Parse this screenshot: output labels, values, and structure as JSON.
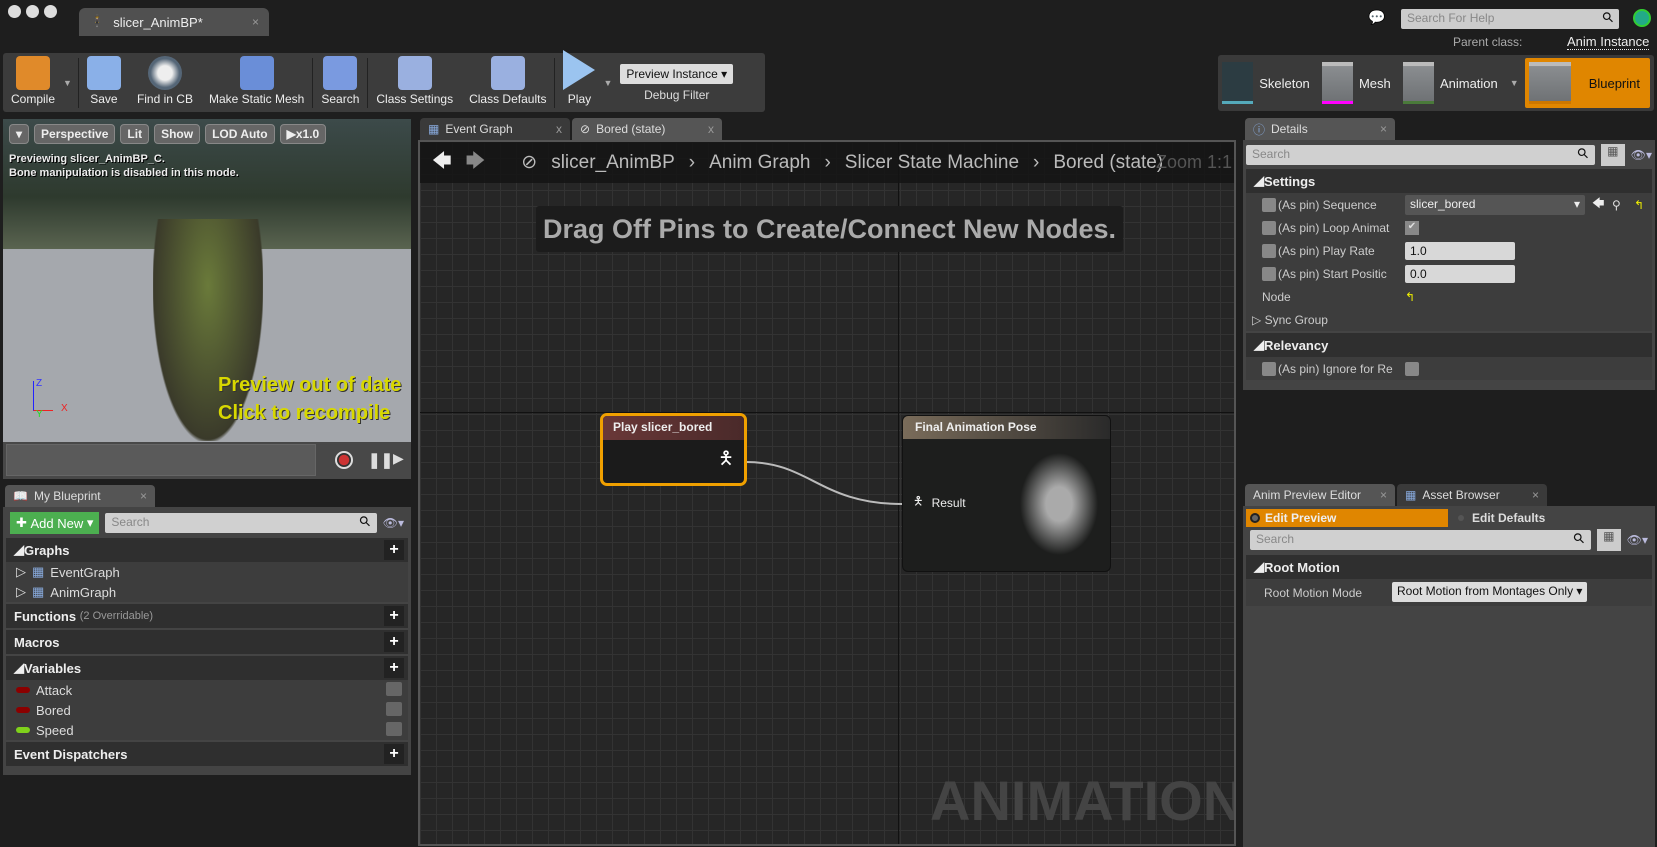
{
  "window": {
    "tab_title": "slicer_AnimBP*",
    "help_placeholder": "Search For Help",
    "parent_class_label": "Parent class:",
    "parent_class": "Anim Instance"
  },
  "toolbar": {
    "compile": "Compile",
    "save": "Save",
    "find_in_cb": "Find in CB",
    "make_static_mesh": "Make Static Mesh",
    "search": "Search",
    "class_settings": "Class Settings",
    "class_defaults": "Class Defaults",
    "play": "Play",
    "debug_select": "Preview Instance",
    "debug_filter": "Debug Filter"
  },
  "modes": {
    "skeleton": "Skeleton",
    "mesh": "Mesh",
    "animation": "Animation",
    "blueprint": "Blueprint"
  },
  "viewport": {
    "perspective": "Perspective",
    "lit": "Lit",
    "show": "Show",
    "lod": "LOD Auto",
    "speed": "x1.0",
    "info1": "Previewing slicer_AnimBP_C.",
    "info2": "Bone manipulation is disabled in this mode.",
    "warn1": "Preview out of date",
    "warn2": "Click to recompile",
    "axis_z": "Z",
    "axis_x": "X",
    "axis_y": "Y"
  },
  "my_blueprint": {
    "tab": "My Blueprint",
    "add_new": "Add New",
    "search_placeholder": "Search",
    "graphs": "Graphs",
    "graph_items": [
      "EventGraph",
      "AnimGraph"
    ],
    "functions": "Functions",
    "functions_note": "(2 Overridable)",
    "macros": "Macros",
    "variables": "Variables",
    "variable_items": [
      {
        "name": "Attack",
        "color": "#8b0000"
      },
      {
        "name": "Bored",
        "color": "#8b0000"
      },
      {
        "name": "Speed",
        "color": "#7fd11b"
      }
    ],
    "event_dispatchers": "Event Dispatchers"
  },
  "graph": {
    "tabs": [
      "Event Graph",
      "Bored (state)"
    ],
    "breadcrumb": [
      "slicer_AnimBP",
      "Anim Graph",
      "Slicer State Machine",
      "Bored (state)"
    ],
    "zoom": "Zoom 1:1",
    "hint": "Drag Off Pins to Create/Connect New Nodes.",
    "watermark": "ANIMATION",
    "node_play": "Play slicer_bored",
    "node_final": "Final Animation Pose",
    "pin_result": "Result"
  },
  "details": {
    "tab": "Details",
    "search_placeholder": "Search",
    "settings": "Settings",
    "props": {
      "sequence_label": "(As pin) Sequence",
      "sequence_value": "slicer_bored",
      "loop_label": "(As pin) Loop Animat",
      "play_rate_label": "(As pin) Play Rate",
      "play_rate": "1.0",
      "start_label": "(As pin) Start Positic",
      "start": "0.0",
      "node_label": "Node",
      "sync_group": "Sync Group"
    },
    "relevancy": "Relevancy",
    "ignore_label": "(As pin) Ignore for Re"
  },
  "anim_preview": {
    "tabs": [
      "Anim Preview Editor",
      "Asset Browser"
    ],
    "edit_preview": "Edit Preview",
    "edit_defaults": "Edit Defaults",
    "search_placeholder": "Search",
    "root_motion": "Root Motion",
    "root_motion_mode_label": "Root Motion Mode",
    "root_motion_mode": "Root Motion from Montages Only"
  },
  "colors": {
    "accent": "#e08600",
    "node_select": "#f0a000"
  }
}
